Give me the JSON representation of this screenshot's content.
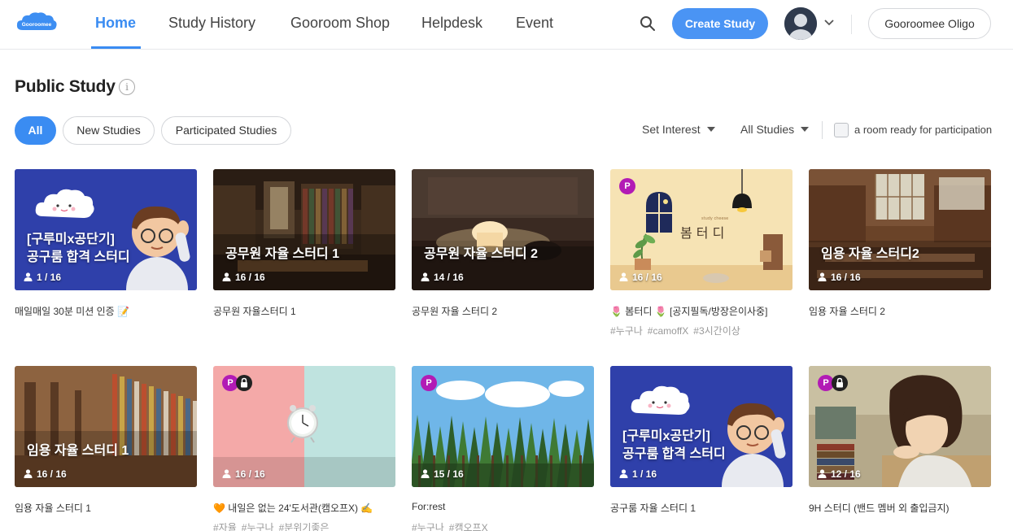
{
  "header": {
    "logo_text": "Gooroomee",
    "nav": [
      {
        "label": "Home",
        "active": true
      },
      {
        "label": "Study History",
        "active": false
      },
      {
        "label": "Gooroom Shop",
        "active": false
      },
      {
        "label": "Helpdesk",
        "active": false
      },
      {
        "label": "Event",
        "active": false
      }
    ],
    "create_study_label": "Create Study",
    "user_name": "Gooroomee Oligo"
  },
  "page": {
    "title": "Public Study",
    "info_glyph": "i"
  },
  "filters": {
    "tabs": [
      {
        "label": "All",
        "active": true
      },
      {
        "label": "New Studies",
        "active": false
      },
      {
        "label": "Participated Studies",
        "active": false
      }
    ],
    "interest_label": "Set Interest",
    "studies_label": "All Studies",
    "ready_label": "a room ready for participation",
    "ready_checked": false
  },
  "colors": {
    "accent": "#3a8cf2",
    "private_badge": "#b21bb5"
  },
  "cards": [
    {
      "overlay": "[구루미x공단기]\n공구룸 합격 스터디",
      "occupancy": "1 / 16",
      "title": "매일매일 30분 미션 인증 📝",
      "tags": [],
      "private": false,
      "locked": false,
      "theme": "gooroomee"
    },
    {
      "overlay": "공무원 자율 스터디 1",
      "occupancy": "16 / 16",
      "title": "공무원 자율스터디 1",
      "tags": [],
      "private": false,
      "locked": false,
      "theme": "library-dark"
    },
    {
      "overlay": "공무원 자율 스터디 2",
      "occupancy": "14 / 16",
      "title": "공무원 자율 스터디 2",
      "tags": [],
      "private": false,
      "locked": false,
      "theme": "lamp-desk"
    },
    {
      "overlay": "",
      "occupancy": "16 / 16",
      "title": "🌷 봄터디 🌷 [공지필독/방장은이사중]",
      "tags": [
        "#누구나",
        "#camoffX",
        "#3시간이상"
      ],
      "private": true,
      "locked": false,
      "theme": "spring",
      "art_text": "봄 터 디",
      "art_small": "study cheese"
    },
    {
      "overlay": "임용 자율 스터디2",
      "occupancy": "16 / 16",
      "title": "임용 자율 스터디 2",
      "tags": [],
      "private": false,
      "locked": false,
      "theme": "library-hall"
    },
    {
      "overlay": "임용 자율 스터디 1",
      "occupancy": "16 / 16",
      "title": "임용 자율 스터디 1",
      "tags": [],
      "private": false,
      "locked": false,
      "theme": "library-shelves"
    },
    {
      "overlay": "",
      "occupancy": "16 / 16",
      "title": "🧡 내일은 없는 24'도서관(캠오프X) ✍️",
      "tags": [
        "#자율",
        "#누구나",
        "#분위기좋은"
      ],
      "private": true,
      "locked": true,
      "theme": "clock"
    },
    {
      "overlay": "",
      "occupancy": "15 / 16",
      "title": "For:rest",
      "tags": [
        "#누구나",
        "#캠오프X"
      ],
      "private": true,
      "locked": false,
      "theme": "forest"
    },
    {
      "overlay": "[구루미x공단기]\n공구룸 합격 스터디",
      "occupancy": "1 / 16",
      "title": "공구룸 자율 스터디 1",
      "tags": [],
      "private": false,
      "locked": false,
      "theme": "gooroomee"
    },
    {
      "overlay": "",
      "occupancy": "12 / 16",
      "title": "9H 스터디 (밴드 멤버 외 출입금지)",
      "tags": [],
      "private": true,
      "locked": true,
      "theme": "anime"
    }
  ]
}
